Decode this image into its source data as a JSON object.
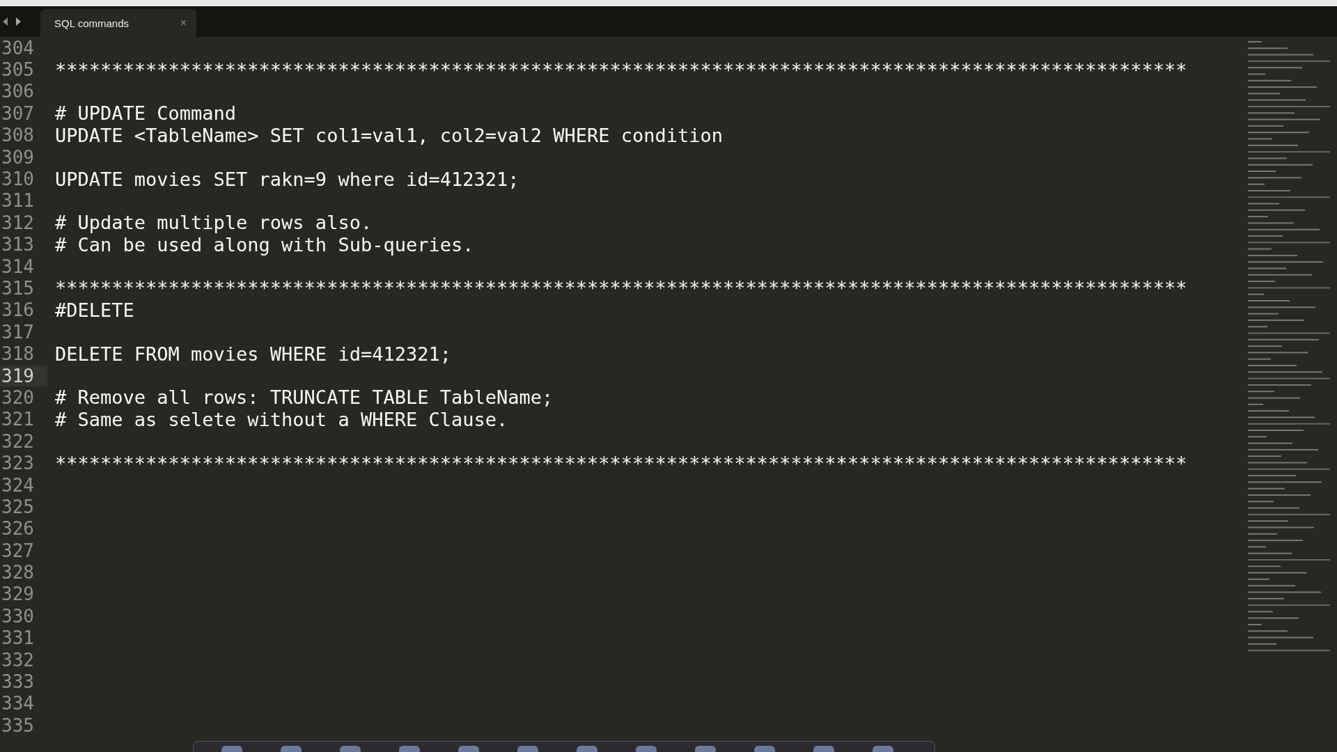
{
  "tab": {
    "label": "SQL commands",
    "close": "×",
    "selected": true
  },
  "lines": [
    {
      "number": "304",
      "current": false
    },
    {
      "number": "305",
      "text": "****************************************************************************************************",
      "current": false
    },
    {
      "number": "306",
      "current": false
    },
    {
      "number": "307",
      "text": "# UPDATE Command",
      "current": false
    },
    {
      "number": "308",
      "text": "UPDATE <TableName> SET col1=val1, col2=val2 WHERE condition",
      "current": false
    },
    {
      "number": "309",
      "current": false
    },
    {
      "number": "310",
      "text": "UPDATE movies SET rakn=9 where id=412321;",
      "current": false
    },
    {
      "number": "311",
      "current": false
    },
    {
      "number": "312",
      "text": "# Update multiple rows also.",
      "current": false
    },
    {
      "number": "313",
      "text": "# Can be used along with Sub-queries.",
      "current": false
    },
    {
      "number": "314",
      "current": false
    },
    {
      "number": "315",
      "text": "****************************************************************************************************",
      "current": false
    },
    {
      "number": "316",
      "text": "#DELETE",
      "current": false
    },
    {
      "number": "317",
      "current": false
    },
    {
      "number": "318",
      "text": "DELETE FROM movies WHERE id=412321;",
      "current": false
    },
    {
      "number": "319",
      "current": true
    },
    {
      "number": "320",
      "text": "# Remove all rows: TRUNCATE TABLE TableName;",
      "current": false
    },
    {
      "number": "321",
      "text": "# Same as selete without a WHERE Clause.",
      "current": false
    },
    {
      "number": "322",
      "current": false
    },
    {
      "number": "323",
      "text": "****************************************************************************************************",
      "current": false
    },
    {
      "number": "324",
      "current": false
    },
    {
      "number": "325",
      "current": false
    },
    {
      "number": "326",
      "current": false
    },
    {
      "number": "327",
      "current": false
    },
    {
      "number": "328",
      "current": false
    },
    {
      "number": "329",
      "current": false
    },
    {
      "number": "330",
      "current": false
    },
    {
      "number": "331",
      "current": false
    },
    {
      "number": "332",
      "current": false
    },
    {
      "number": "333",
      "current": false
    },
    {
      "number": "334",
      "current": false
    },
    {
      "number": "335",
      "current": false
    }
  ]
}
